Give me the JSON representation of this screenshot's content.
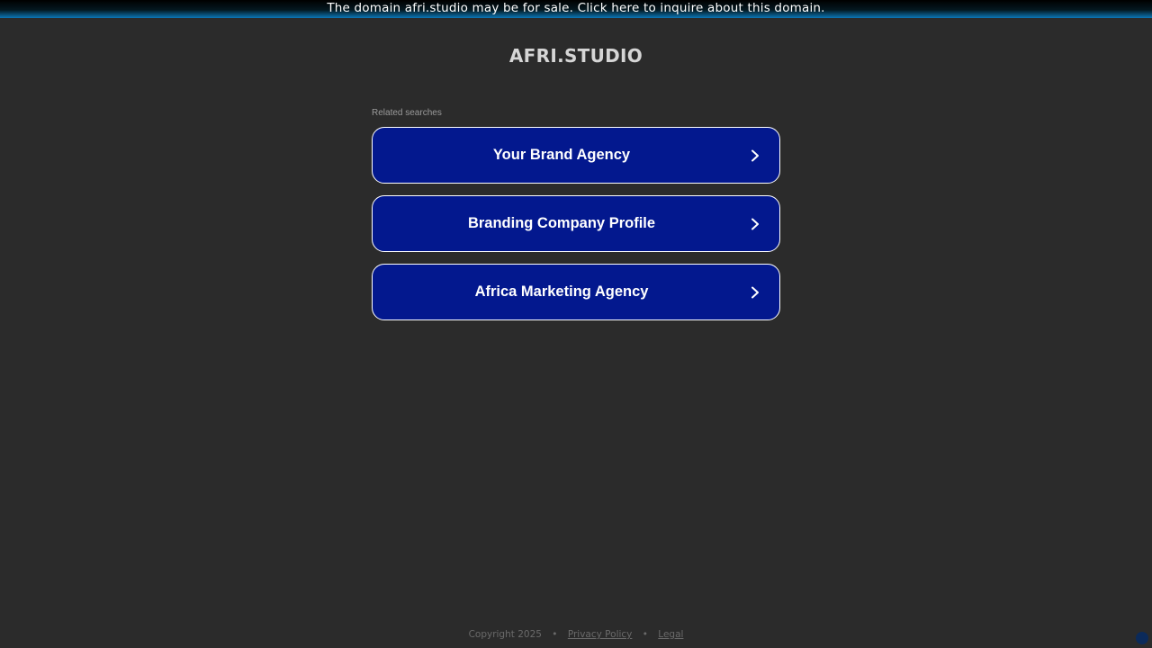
{
  "banner": {
    "text": "The domain afri.studio may be for sale. Click here to inquire about this domain."
  },
  "site": {
    "title": "AFRI.STUDIO"
  },
  "related": {
    "label": "Related searches",
    "items": [
      {
        "label": "Your Brand Agency",
        "icon": "chevron-right-icon"
      },
      {
        "label": "Branding Company Profile",
        "icon": "chevron-right-icon"
      },
      {
        "label": "Africa Marketing Agency",
        "icon": "chevron-right-icon"
      }
    ]
  },
  "footer": {
    "copyright": "Copyright 2025",
    "separator": "•",
    "privacy_label": "Privacy Policy",
    "legal_label": "Legal"
  },
  "colors": {
    "background": "#2b2b2b",
    "button_fill": "#03188e",
    "button_border": "#ffffff",
    "banner_accent": "#0b76b5"
  }
}
